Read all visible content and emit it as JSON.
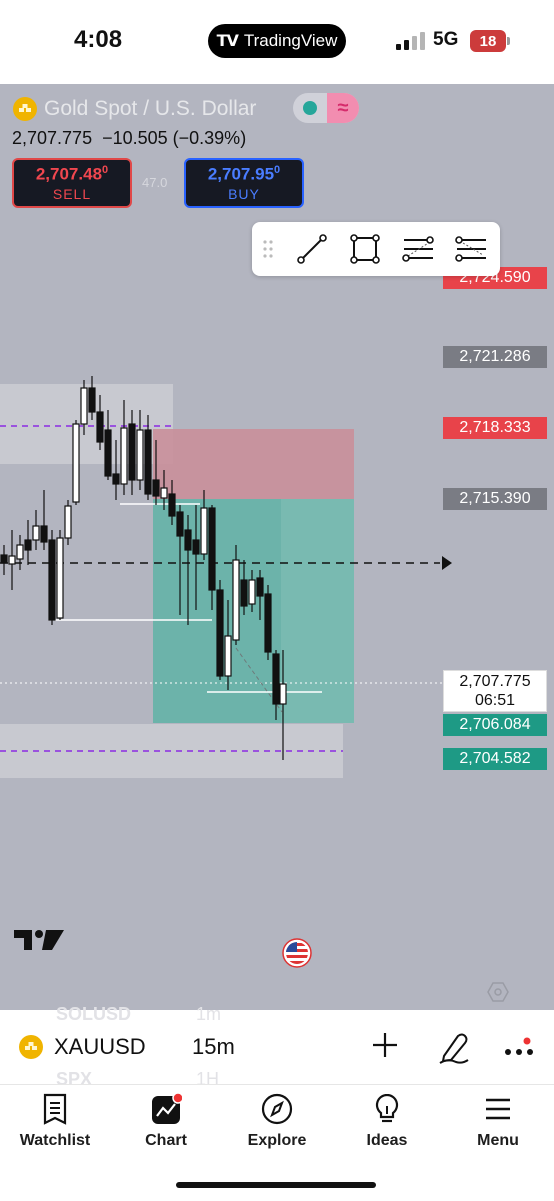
{
  "status_bar": {
    "time": "4:08",
    "app_name": "TradingView",
    "network": "5G",
    "battery": "18"
  },
  "chart": {
    "symbol_title": "Gold Spot / U.S. Dollar",
    "price_change": "2,707.775  −10.505 (−0.39%)",
    "sell": {
      "price": "2,707.48",
      "price_small": "0",
      "label": "SELL"
    },
    "buy": {
      "price": "2,707.95",
      "price_small": "0",
      "label": "BUY"
    },
    "spread": "47.0",
    "price_labels": [
      {
        "value": "2,724.590",
        "color": "#e8434a"
      },
      {
        "value": "2,721.286",
        "color": "#7a7c84"
      },
      {
        "value": "2,718.333",
        "color": "#e8434a"
      },
      {
        "value": "2,715.390",
        "color": "#7a7c84"
      },
      {
        "value": "2,706.084",
        "color": "#1e9a85"
      },
      {
        "value": "2,704.582",
        "color": "#1e9a85"
      }
    ],
    "current_price": {
      "value": "2,707.775",
      "countdown": "06:51"
    },
    "colors": {
      "profit_zone": "#5fb3a6",
      "loss_zone": "#c98f9a",
      "background": "#b3b5c0"
    }
  },
  "drawing_toolbar": {
    "tools": [
      "drag-handle-icon",
      "trend-line-icon",
      "rectangle-icon",
      "fib-retracement-icon",
      "position-tool-icon"
    ]
  },
  "bottom_bar": {
    "ghost_top_symbol": "SOLUSD",
    "ghost_top_interval": "1m",
    "ghost_bottom_symbol": "SPX",
    "ghost_bottom_interval": "1H",
    "symbol": "XAUUSD",
    "interval": "15m"
  },
  "tabs": [
    {
      "label": "Watchlist",
      "icon": "watchlist-icon"
    },
    {
      "label": "Chart",
      "icon": "chart-icon"
    },
    {
      "label": "Explore",
      "icon": "compass-icon"
    },
    {
      "label": "Ideas",
      "icon": "lightbulb-icon"
    },
    {
      "label": "Menu",
      "icon": "menu-icon"
    }
  ]
}
